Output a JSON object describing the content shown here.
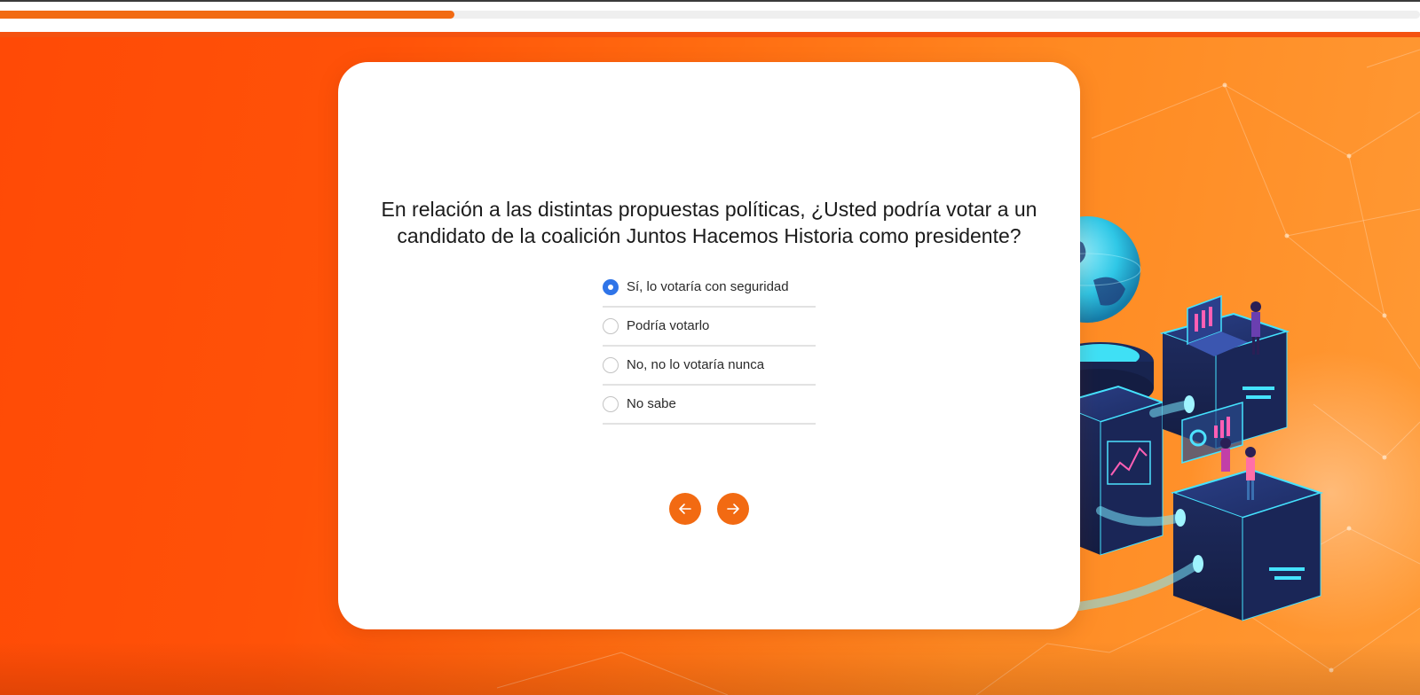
{
  "progress": {
    "value": 0.32
  },
  "survey": {
    "question": "En relación a las distintas propuestas políticas, ¿Usted podría votar a un candidato de la coalición Juntos Hacemos Historia como presidente?",
    "options": [
      {
        "label": "Sí, lo votaría con seguridad",
        "selected": true
      },
      {
        "label": "Podría votarlo",
        "selected": false
      },
      {
        "label": "No, no lo votaría nunca",
        "selected": false
      },
      {
        "label": "No sabe",
        "selected": false
      }
    ]
  },
  "nav": {
    "prev_icon": "arrow-left-icon",
    "next_icon": "arrow-right-icon"
  },
  "colors": {
    "accent": "#f26a12",
    "radio_selected": "#2f74e8",
    "background_start": "#ff4a06",
    "background_end": "#ff9a35"
  }
}
